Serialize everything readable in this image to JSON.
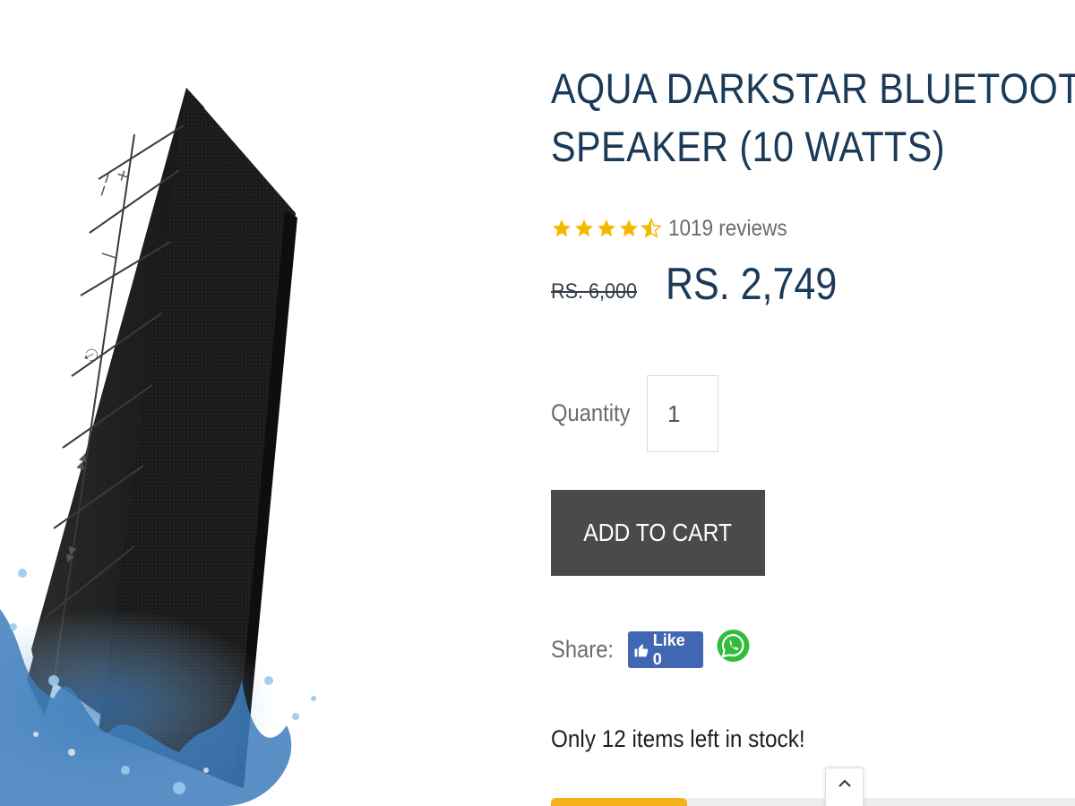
{
  "product": {
    "title_line1": "AQUA DARKSTAR BLUETOOTH",
    "title_line2": "SPEAKER (10 WATTS)",
    "rating": 4.5,
    "reviews_text": "1019 reviews",
    "old_price": "RS. 6,000",
    "new_price": "RS. 2,749",
    "image_alt": "speaker-in-water"
  },
  "quantity": {
    "label": "Quantity",
    "value": "1"
  },
  "cart": {
    "add_label": "ADD TO CART"
  },
  "share": {
    "label": "Share:",
    "fb_like_label": "Like 0"
  },
  "stock": {
    "text": "Only 12 items left in stock!",
    "level": 0.26
  },
  "colors": {
    "title": "#1b3a57",
    "star": "#f5b800",
    "button_bg": "#4a4a4a",
    "facebook": "#4267b2",
    "whatsapp": "#2fbe3b",
    "stock_bar": "#f5b11c"
  },
  "icons": {
    "scroll_top": "chevron-up-icon",
    "fb": "thumbs-up-icon",
    "whatsapp": "whatsapp-icon"
  }
}
